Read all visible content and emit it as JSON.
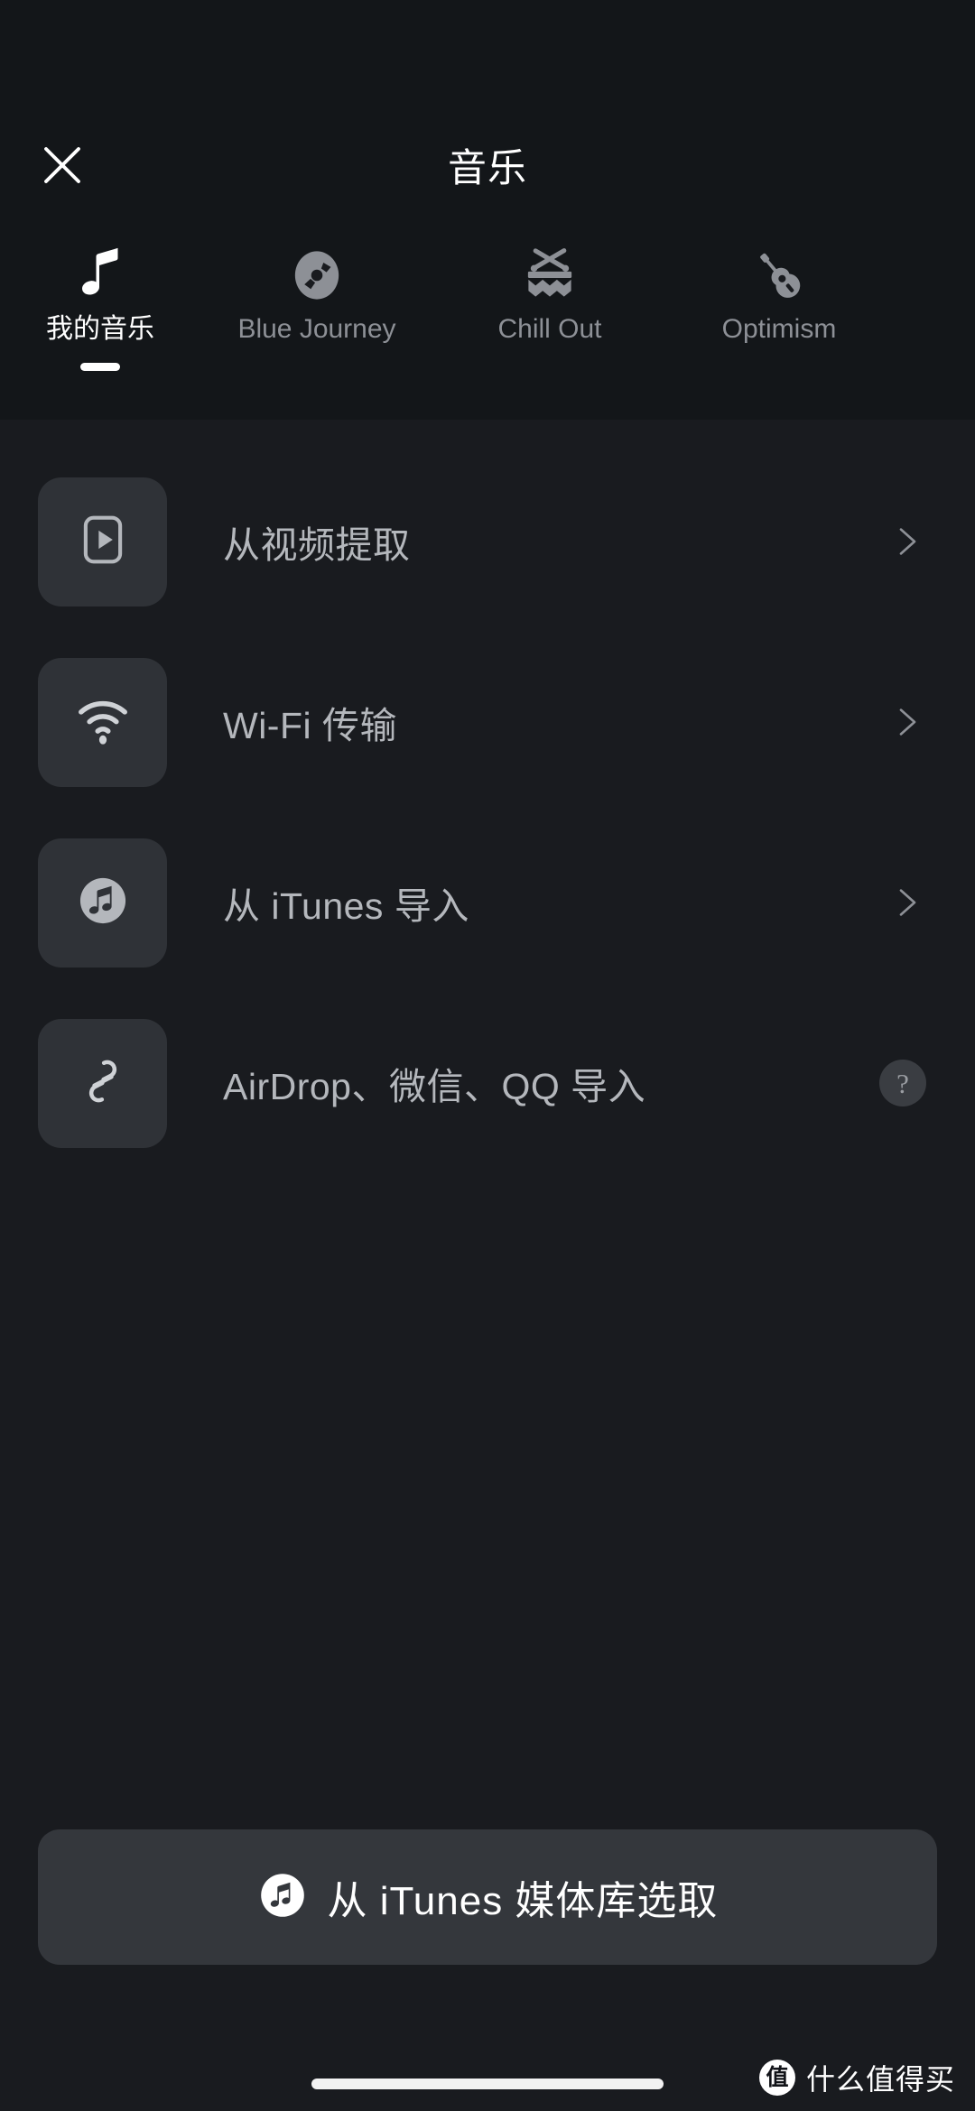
{
  "window": {
    "title": "音乐"
  },
  "navbar": {
    "close_icon": "close-icon",
    "title": "音乐"
  },
  "tabs": [
    {
      "label": "我的音乐",
      "icon": "music-note-icon",
      "active": true
    },
    {
      "label": "Blue Journey",
      "icon": "vinyl-record-icon",
      "active": false
    },
    {
      "label": "Chill Out",
      "icon": "drum-icon",
      "active": false
    },
    {
      "label": "Optimism",
      "icon": "acoustic-guitar-icon",
      "active": false
    }
  ],
  "list": [
    {
      "label": "从视频提取",
      "icon": "video-play-icon",
      "accessory": "chevron-right-icon"
    },
    {
      "label": "Wi-Fi 传输",
      "icon": "wifi-icon",
      "accessory": "chevron-right-icon"
    },
    {
      "label": "从 iTunes 导入",
      "icon": "itunes-note-icon",
      "accessory": "chevron-right-icon"
    },
    {
      "label": "AirDrop、微信、QQ 导入",
      "icon": "link-icon",
      "accessory": "help-icon",
      "help_glyph": "?"
    }
  ],
  "cta": {
    "label": "从 iTunes 媒体库选取",
    "icon": "itunes-note-icon"
  },
  "watermark": {
    "logo_glyph": "值",
    "text": "什么值得买"
  },
  "colors": {
    "header_bg": "#131619",
    "content_bg": "#191b1f",
    "tile_bg": "#2f3237",
    "cta_bg": "#34373c",
    "text_primary": "#ffffff",
    "text_secondary": "#b4b7bc",
    "text_muted": "#8d9096",
    "icon_muted": "#9a9da2"
  }
}
